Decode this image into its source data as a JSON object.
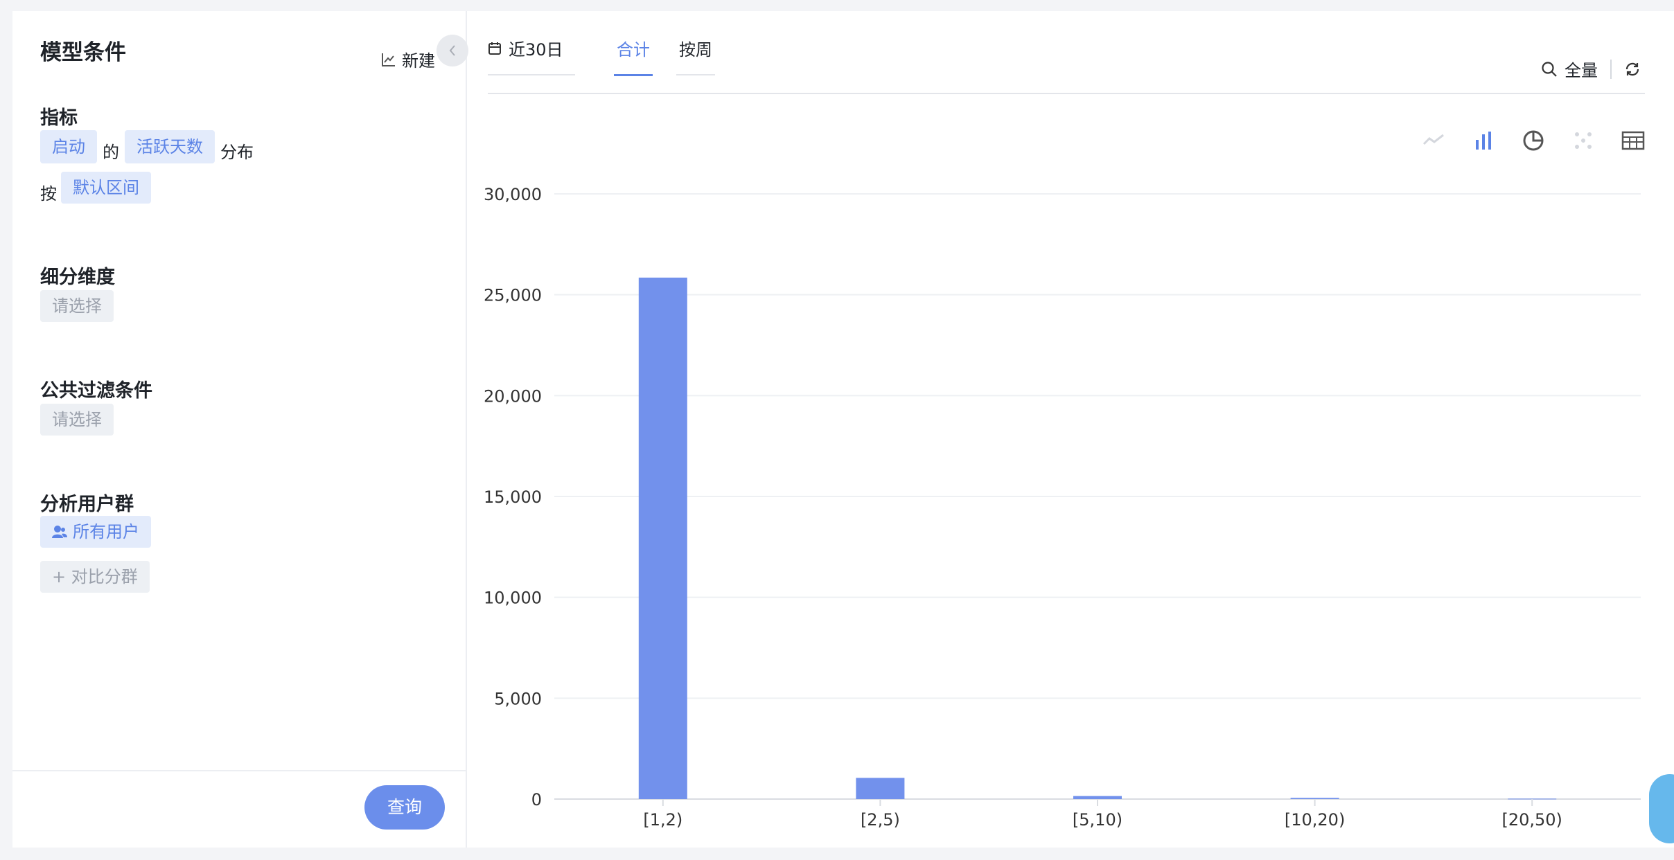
{
  "left_panel": {
    "title": "模型条件",
    "new_label": "新建",
    "metric": {
      "section_label": "指标",
      "event": "启动",
      "connector": "的",
      "property": "活跃天数",
      "suffix": "分布",
      "by_label": "按",
      "interval": "默认区间"
    },
    "breakdown": {
      "section_label": "细分维度",
      "placeholder": "请选择"
    },
    "filter": {
      "section_label": "公共过滤条件",
      "placeholder": "请选择"
    },
    "user_group": {
      "section_label": "分析用户群",
      "all_users": "所有用户",
      "compare": "+ 对比分群"
    },
    "query_label": "查询"
  },
  "right_panel": {
    "date_range": "近30日",
    "tabs": [
      {
        "label": "合计",
        "active": true
      },
      {
        "label": "按周",
        "active": false
      }
    ],
    "scope_label": "全量",
    "chart_type_icons": [
      "line-chart-icon",
      "bar-chart-icon",
      "pie-chart-icon",
      "scatter-chart-icon",
      "table-icon"
    ],
    "active_chart_icon": "bar-chart-icon"
  },
  "colors": {
    "accent": "#5b83e6",
    "bar": "#7291ec",
    "tag_bg": "#e3ebfb"
  },
  "chart_data": {
    "type": "bar",
    "categories": [
      "[1,2)",
      "[2,5)",
      "[5,10)",
      "[10,20)",
      "[20,50)"
    ],
    "values": [
      25850,
      1050,
      150,
      60,
      20
    ],
    "ylim": [
      0,
      30000
    ],
    "yticks": [
      "0",
      "5,000",
      "10,000",
      "15,000",
      "20,000",
      "25,000",
      "30,000"
    ],
    "grid": true
  }
}
